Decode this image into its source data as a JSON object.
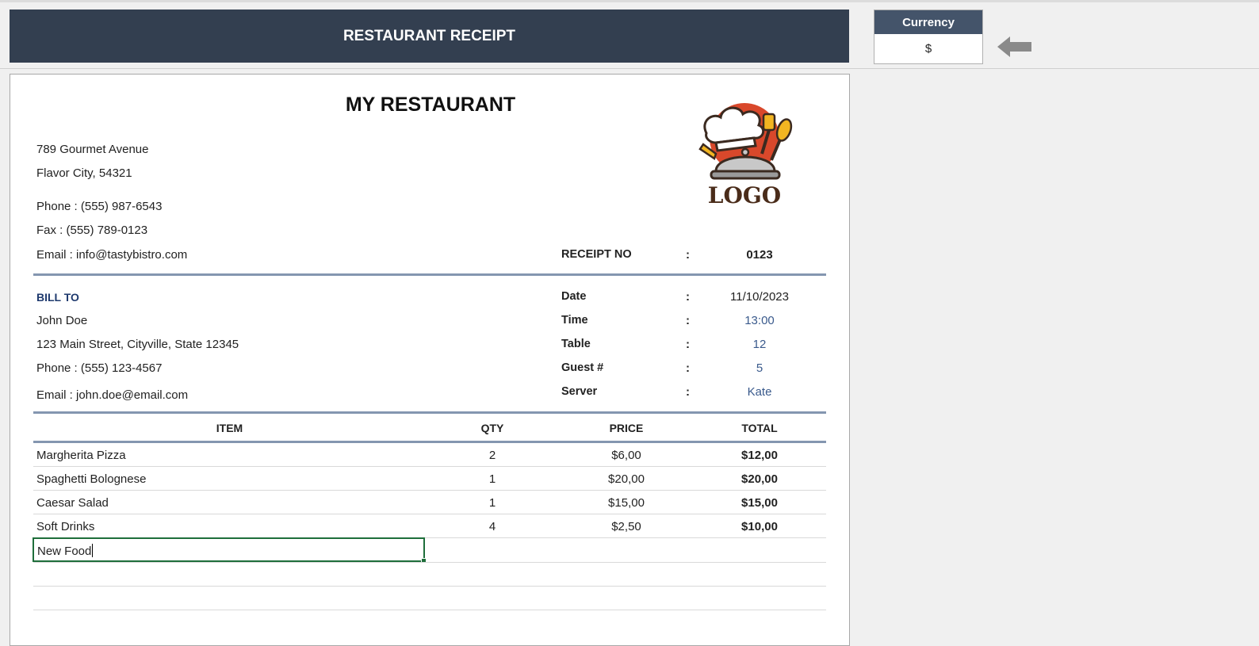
{
  "header": {
    "title": "RESTAURANT RECEIPT"
  },
  "currency": {
    "label": "Currency",
    "value": "$"
  },
  "restaurant": {
    "name": "MY RESTAURANT",
    "address1": "789 Gourmet Avenue",
    "address2": "Flavor City,  54321",
    "phone": "Phone : (555) 987-6543",
    "fax": "Fax : (555) 789-0123",
    "email": "Email : info@tastybistro.com",
    "logo_text": "LOGO"
  },
  "receipt": {
    "no_label": "RECEIPT NO",
    "no_value": "0123",
    "date_label": "Date",
    "date_value": "11/10/2023",
    "time_label": "Time",
    "time_value": "13:00",
    "table_label": "Table",
    "table_value": "12",
    "guests_label": "Guest #",
    "guests_value": "5",
    "server_label": "Server",
    "server_value": "Kate",
    "colon": ":"
  },
  "bill_to": {
    "heading": "BILL TO",
    "name": "John Doe",
    "address": "123 Main Street, Cityville, State 12345",
    "phone": "Phone : (555) 123-4567",
    "email": "Email : john.doe@email.com"
  },
  "table": {
    "headers": {
      "item": "ITEM",
      "qty": "QTY",
      "price": "PRICE",
      "total": "TOTAL"
    },
    "rows": [
      {
        "item": "Margherita Pizza",
        "qty": "2",
        "price": "$6,00",
        "total": "$12,00"
      },
      {
        "item": "Spaghetti Bolognese",
        "qty": "1",
        "price": "$20,00",
        "total": "$20,00"
      },
      {
        "item": "Caesar Salad",
        "qty": "1",
        "price": "$15,00",
        "total": "$15,00"
      },
      {
        "item": "Soft Drinks",
        "qty": "4",
        "price": "$2,50",
        "total": "$10,00"
      }
    ],
    "editing_value": "New Food"
  },
  "colors": {
    "banner": "#333f50",
    "rule": "#8496b0",
    "selection": "#1e6e3a"
  }
}
